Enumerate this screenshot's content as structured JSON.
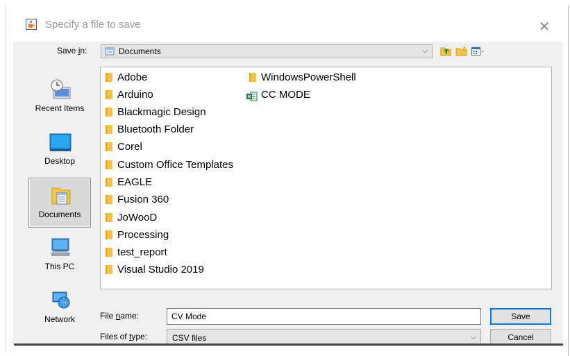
{
  "window": {
    "title": "Specify a file to save",
    "title_icon": "java-cup-icon",
    "close_glyph": "✕"
  },
  "save_in": {
    "label_prefix": "Save ",
    "label_accel": "i",
    "label_suffix": "n:",
    "value": "Documents",
    "icon": "documents-folder-icon"
  },
  "toolbar": {
    "up_icon": "up-one-level-icon",
    "new_folder_icon": "new-folder-icon",
    "view_menu_icon": "view-menu-icon"
  },
  "places": [
    {
      "label": "Recent Items",
      "icon": "recent-items-icon",
      "selected": false
    },
    {
      "label": "Desktop",
      "icon": "desktop-icon",
      "selected": false
    },
    {
      "label": "Documents",
      "icon": "documents-icon",
      "selected": true
    },
    {
      "label": "This PC",
      "icon": "this-pc-icon",
      "selected": false
    },
    {
      "label": "Network",
      "icon": "network-icon",
      "selected": false
    }
  ],
  "files": {
    "column1": [
      {
        "name": "Adobe",
        "type": "folder"
      },
      {
        "name": "Arduino",
        "type": "folder"
      },
      {
        "name": "Blackmagic Design",
        "type": "folder"
      },
      {
        "name": "Bluetooth Folder",
        "type": "folder"
      },
      {
        "name": "Corel",
        "type": "folder"
      },
      {
        "name": "Custom Office Templates",
        "type": "folder"
      },
      {
        "name": "EAGLE",
        "type": "folder"
      },
      {
        "name": "Fusion 360",
        "type": "folder"
      },
      {
        "name": "JoWooD",
        "type": "folder"
      },
      {
        "name": "Processing",
        "type": "folder"
      },
      {
        "name": "test_report",
        "type": "folder"
      },
      {
        "name": "Visual Studio 2019",
        "type": "folder"
      }
    ],
    "column2": [
      {
        "name": "WindowsPowerShell",
        "type": "folder"
      },
      {
        "name": "CC MODE",
        "type": "excel"
      }
    ]
  },
  "file_name": {
    "label_prefix": "File ",
    "label_accel": "n",
    "label_suffix": "ame:",
    "value": "CV Mode"
  },
  "file_type": {
    "label_prefix": "Files of ",
    "label_accel": "t",
    "label_suffix": "ype:",
    "value": "CSV files"
  },
  "buttons": {
    "save": "Save",
    "cancel": "Cancel"
  },
  "colors": {
    "folder": "#f4c34c",
    "accent": "#0078d7",
    "excel": "#1e7145"
  }
}
